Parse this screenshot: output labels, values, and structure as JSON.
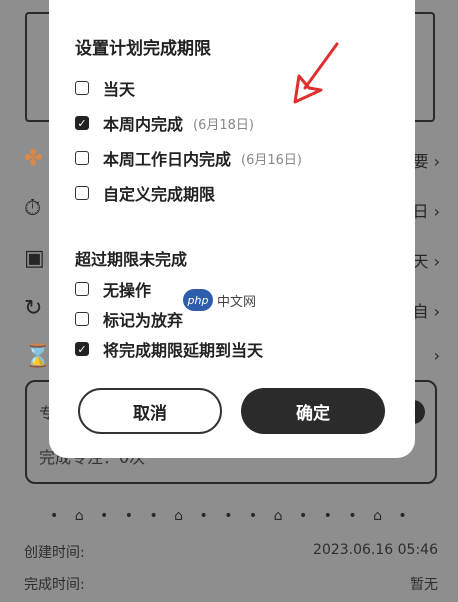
{
  "background": {
    "rows": [
      {
        "icon": "apps-icon",
        "glyph": "✤",
        "right": "要 ›"
      },
      {
        "icon": "timer-icon",
        "glyph": "⏱",
        "right": "日 ›"
      },
      {
        "icon": "calendar-check-icon",
        "glyph": "▣",
        "right": "天 ›"
      },
      {
        "icon": "repeat-icon",
        "glyph": "↻",
        "right": "自 ›"
      },
      {
        "icon": "hourglass-icon",
        "glyph": "⌛",
        "right": "›"
      }
    ],
    "card_stub": "专",
    "card_label": "完成专注：0次",
    "created_label": "创建时间:",
    "created_value": "2023.06.16 05:46",
    "completed_label": "完成时间:",
    "completed_value": "暂无"
  },
  "dialog": {
    "title": "设置计划完成期限",
    "options": [
      {
        "label": "当天",
        "hint": "",
        "checked": false
      },
      {
        "label": "本周内完成",
        "hint": "(6月18日)",
        "checked": true
      },
      {
        "label": "本周工作日内完成",
        "hint": "(6月16日)",
        "checked": false
      },
      {
        "label": "自定义完成期限",
        "hint": "",
        "checked": false
      }
    ],
    "overdue_title": "超过期限未完成",
    "overdue_options": [
      {
        "label": "无操作",
        "checked": false
      },
      {
        "label": "标记为放弃",
        "checked": false
      },
      {
        "label": "将完成期限延期到当天",
        "checked": true
      }
    ],
    "cancel_label": "取消",
    "confirm_label": "确定"
  },
  "watermark": {
    "logo": "php",
    "text": "中文网"
  },
  "colors": {
    "arrow": "#e0302e",
    "primary_button": "#2b2b2b"
  }
}
